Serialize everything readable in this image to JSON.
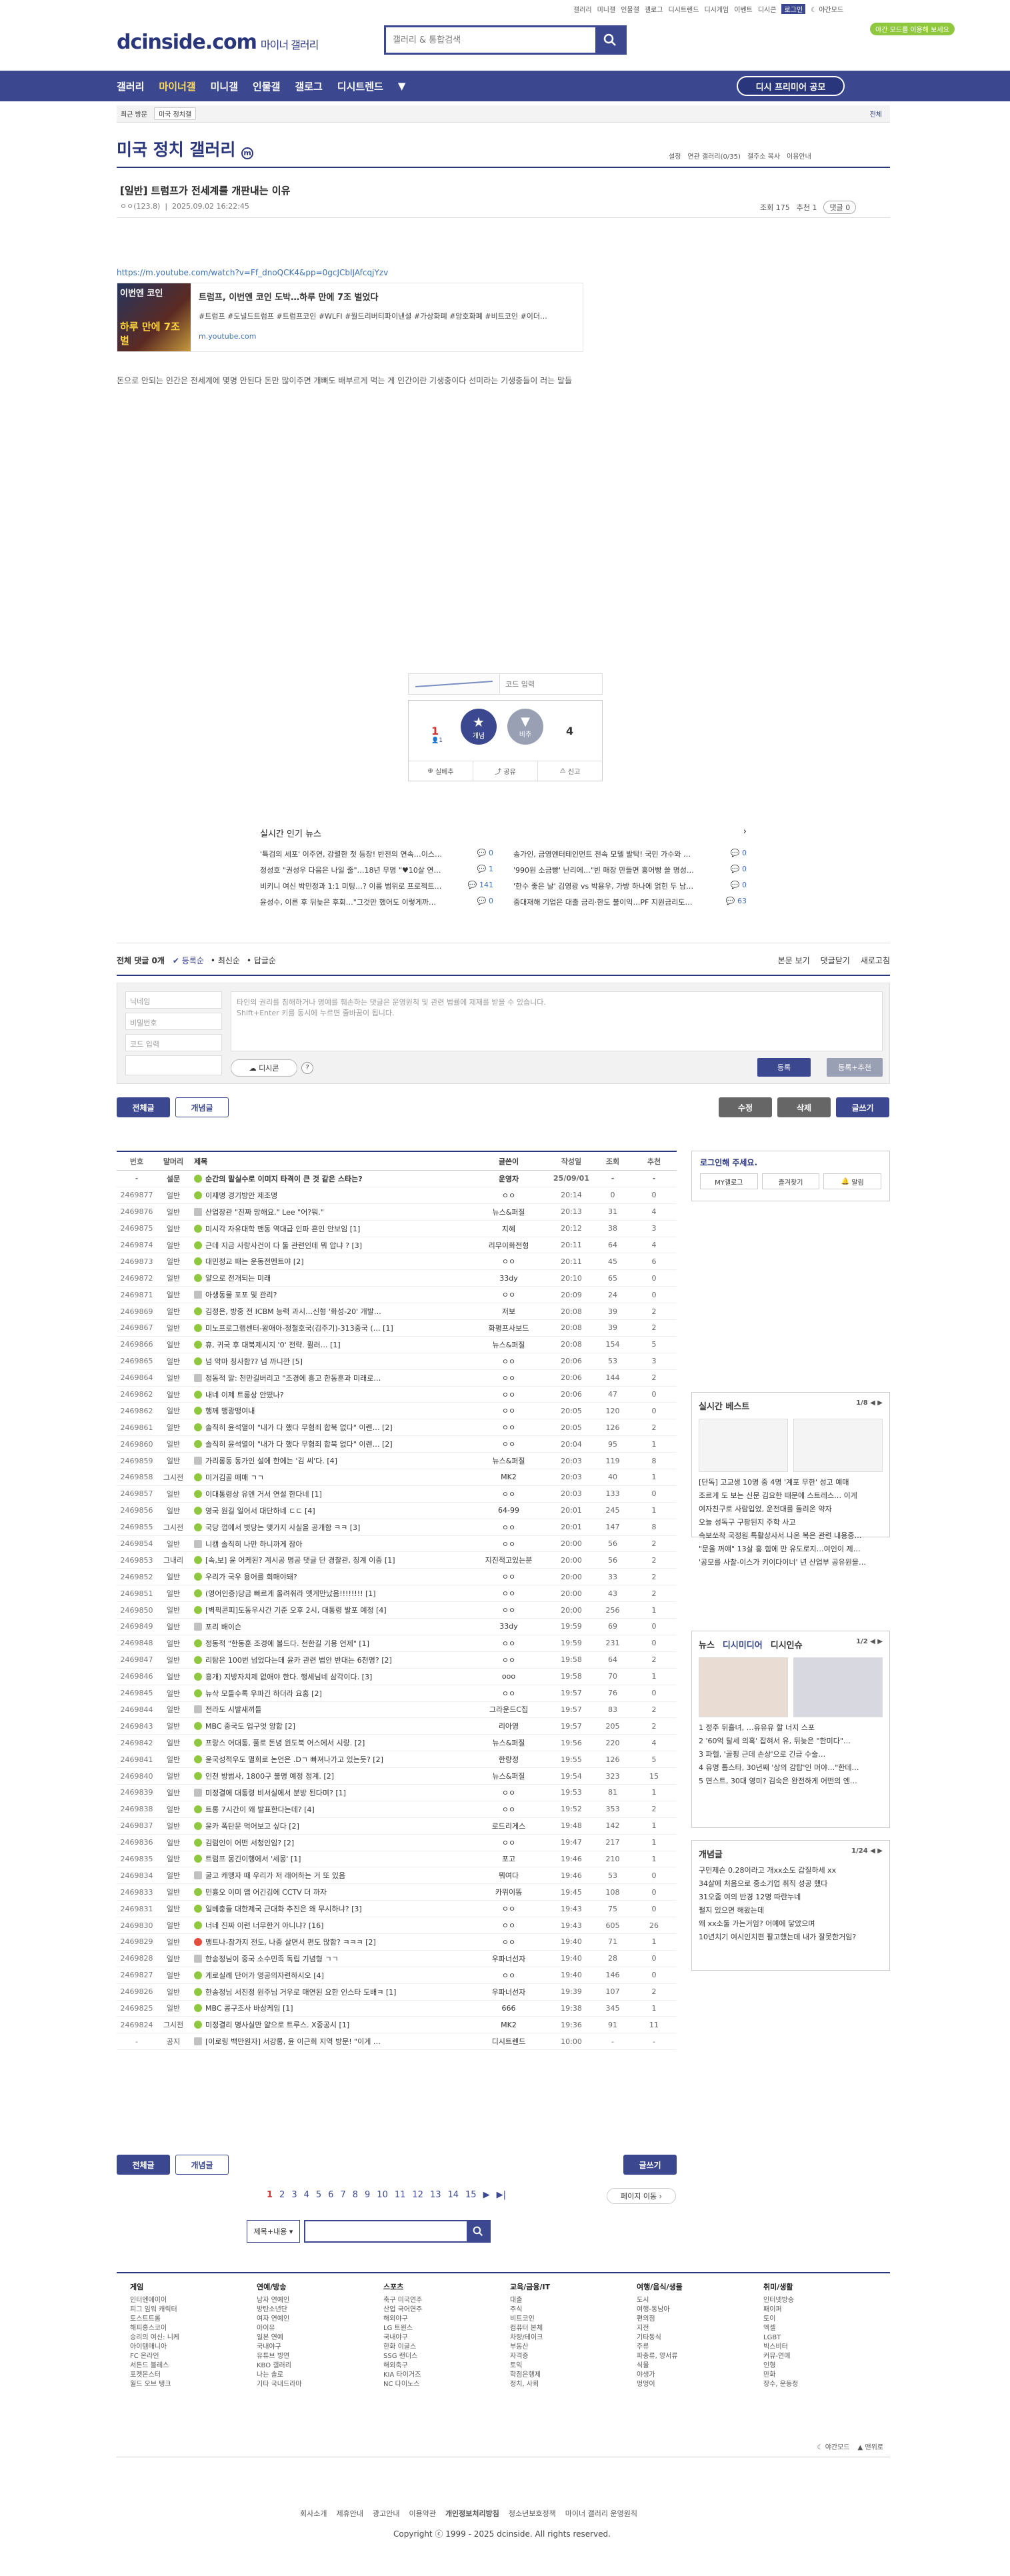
{
  "top": {
    "links": [
      "갤러리",
      "미니갤",
      "인물갤",
      "갤로그",
      "디시트렌드",
      "디시게임",
      "이벤트",
      "디시콘"
    ],
    "login": "로그인",
    "dark_label": "야간모드"
  },
  "logo": {
    "brand": "dcinside.com",
    "sub": "마이너 갤러리"
  },
  "search": {
    "placeholder": "갤러리 & 통합검색"
  },
  "dark_tip": "야간 모드를 이용해 보세요",
  "gnb": {
    "items": [
      "갤러리",
      "마이너갤",
      "미니갤",
      "인물갤",
      "갤로그",
      "디시트렌드"
    ],
    "recruit": "디시 프리미어 공모"
  },
  "visit": {
    "label": "최근 방문",
    "tag": "미국 정치갤",
    "all": "전체"
  },
  "gallery": {
    "title": "미국 정치 갤러리",
    "options": [
      "설정",
      "연관 갤러리(0/35)",
      "갤주소 복사",
      "이용안내"
    ]
  },
  "post": {
    "title": "[일반] 트럼프가 전세계를 개판내는 이유",
    "author": "ㅇㅇ(123.8)",
    "date": "2025.09.02 16:22:45",
    "views": "조회 175",
    "recommend": "추천 1",
    "comments": "댓글 0",
    "link": "https://m.youtube.com/watch?v=Ff_dnoQCK4&pp=0gcJCbIJAfcqjYzv",
    "card_title": "트럼프, 이번엔 코인 도박…하루 만에 7조 벌었다",
    "card_desc": "#트럼프 #도널드트럼프 #트럼프코인 #WLFI #월드리버티파이낸셜 #가상화폐 #암호화폐 #비트코인 #이더…",
    "card_url": "m.youtube.com",
    "thumb_text": "이번엔 코인",
    "thumb_text2": "하루 만에 7조 벌",
    "body": "돈으로 안되는 인간은 전세계에 몇명 안된다 돈만 많이주면 개뼈도 배부르게 먹는 게 인간이란 기생충이다 선미라는 기생충들이 러는 말들"
  },
  "captcha": {
    "placeholder": "코드 입력"
  },
  "vote": {
    "up_count": "1",
    "up_fixed": "1",
    "up_label": "개념",
    "down_label": "비추",
    "down_count": "4",
    "actions": [
      "실베추",
      "공유",
      "신고"
    ]
  },
  "popular": {
    "title": "실시간 인기 뉴스",
    "items": [
      {
        "t": "'특검의 세포' 이주연, 강렬한 첫 등장! 반전의 연속…이스…",
        "c": "0"
      },
      {
        "t": "송가인, 금영엔터테인먼트 전속 모델 발탁! 국민 가수와 …",
        "c": "0"
      },
      {
        "t": "정성호 \"권성우 다음은 나일 줄\"…18년 무명 \"♥10살 연…",
        "c": "1"
      },
      {
        "t": "'990원 소금빵' 난리에…\"빈 매장 만들면 홍어빵 쓸 명성…",
        "c": "0"
      },
      {
        "t": "비키니 여신 박민정과 1:1 미팅…? 이름 범위로 프로젝트…",
        "c": "141"
      },
      {
        "t": "'한수 좋은 날' 김영광 vs 박용우, 가방 하나에 얽힌 두 남…",
        "c": "0"
      },
      {
        "t": "윤성수, 이른 후 뒤늦은 후회…\"그것만 했어도 이렇게까…",
        "c": "0"
      },
      {
        "t": "중대재해 기업은 대출 금리·한도 불이익…PF 지원금리도…",
        "c": "63"
      }
    ]
  },
  "cbar": {
    "count": "전체 댓글 0개",
    "sorts": [
      "등록순",
      "최신순",
      "답글순"
    ],
    "right": [
      "본문 보기",
      "댓글닫기",
      "새로고침"
    ]
  },
  "cform": {
    "nick": "닉네임",
    "pw": "비밀번호",
    "code": "코드 입력",
    "text": "타인의 권리를 침해하거나 명예를 훼손하는 댓글은 운영원칙 및 관련 법률에 제재를 받을 수 있습니다.\nShift+Enter 키를 동시에 누르면 줄바꿈이 됩니다.",
    "dccon": "디시콘",
    "submit": "등록",
    "submit2": "등록+추천"
  },
  "bnav": {
    "all": "전체글",
    "concept": "개념글",
    "edit": "수정",
    "delete": "삭제",
    "write": "글쓰기"
  },
  "table": {
    "headers": [
      "번호",
      "말머리",
      "제목",
      "글쓴이",
      "작성일",
      "조회",
      "추천"
    ],
    "rows": [
      [
        "-",
        "설문",
        "순간의 말실수로 이미지 타격이 큰 것 같은 스타는?",
        "운영자",
        "25/09/01",
        "-",
        "-"
      ],
      [
        "2469877",
        "일반",
        "이재명 경기방안 제조명",
        "ㅇㅇ",
        "20:14",
        "0",
        "0"
      ],
      [
        "2469876",
        "일반",
        "산업장관 \"진짜 망해요.\" Lee \"어?뭐.\"",
        "뉴스&퍼질",
        "20:13",
        "31",
        "4"
      ],
      [
        "2469875",
        "일반",
        "미시각 자유대학 맨동 역대급 인파 흔인 안보임 [1]",
        "지혜",
        "20:12",
        "38",
        "3"
      ],
      [
        "2469874",
        "일반",
        "근데 지금 사랑사건이 다 둘 관련인데 뭐 압냐 ? [3]",
        "리무이화전형",
        "20:11",
        "64",
        "4"
      ],
      [
        "2469873",
        "일반",
        "대민정교 패는 운동전멘트야 [2]",
        "ㅇㅇ",
        "20:11",
        "45",
        "6"
      ],
      [
        "2469872",
        "일반",
        "얄으로 전개되는 미래",
        "33dy",
        "20:10",
        "65",
        "0"
      ],
      [
        "2469871",
        "일반",
        "아생동물 포포 및 관리?",
        "ㅇㅇ",
        "20:09",
        "24",
        "0"
      ],
      [
        "2469869",
        "일반",
        "김정은, 방중 전 ICBM 능력 과시…신형 '화성-20' 개발…",
        "저보",
        "20:08",
        "39",
        "2"
      ],
      [
        "2469867",
        "일반",
        "미노프로그램센터-왕애아-정철호국(김주기)-313중국 (… [1]",
        "화평프사보드",
        "20:08",
        "39",
        "2"
      ],
      [
        "2469866",
        "일반",
        "휴, 귀국 후 대북제시지 '0' 전략. 퓔러… [1]",
        "뉴스&퍼질",
        "20:08",
        "154",
        "5"
      ],
      [
        "2469865",
        "일반",
        "넘 악마 칭사함?? 넘 까니깐 [5]",
        "ㅇㅇ",
        "20:06",
        "53",
        "3"
      ],
      [
        "2469864",
        "일반",
        "정동적 말: 천만길버리고 \"조경에 흥고 한동훈과 미래로…",
        "ㅇㅇ",
        "20:06",
        "144",
        "2"
      ],
      [
        "2469862",
        "일반",
        "내네 이제 트롱상 안떴나?",
        "ㅇㅇ",
        "20:06",
        "47",
        "0"
      ],
      [
        "2469862",
        "일반",
        "행께 맹광맹여내",
        "ㅇㅇ",
        "20:05",
        "120",
        "0"
      ],
      [
        "2469861",
        "일반",
        "솔직히 윤석열이 \"내가 다 했다 무혐죄 합북 없다\" 이렌… [2]",
        "ㅇㅇ",
        "20:05",
        "126",
        "2"
      ],
      [
        "2469860",
        "일반",
        "솔직히 윤석열이 \"내가 다 했다 무혐죄 합북 없다\" 이렌… [2]",
        "ㅇㅇ",
        "20:04",
        "95",
        "1"
      ],
      [
        "2469859",
        "일반",
        "가리롱동 동가인 설에 한에는 '김 씨'다. [4]",
        "뉴스&퍼질",
        "20:03",
        "119",
        "8"
      ],
      [
        "2469858",
        "그시전",
        "미거김골 매매 ㄱㄱ",
        "MK2",
        "20:03",
        "40",
        "1"
      ],
      [
        "2469857",
        "일반",
        "이대통령상 유엔 거서 연설 한다네 [1]",
        "ㅇㅇ",
        "20:03",
        "133",
        "0"
      ],
      [
        "2469856",
        "일반",
        "영국 원길 일어서 대단하네 ㄷㄷ [4]",
        "64-99",
        "20:01",
        "245",
        "1"
      ],
      [
        "2469855",
        "그시전",
        "국당 껍에서 볏당는 맺가지 사실을 공개함 ㅋㅋ [3]",
        "ㅇㅇ",
        "20:01",
        "147",
        "8"
      ],
      [
        "2469854",
        "일반",
        "니캠 솔직히 나만 하니까게 잠아",
        "ㅇㅇ",
        "20:00",
        "56",
        "2"
      ],
      [
        "2469853",
        "그내리",
        "[속,보] 윤 어케된? 계시공 명공 댓글 단 경찰관, 징계 이중 [1]",
        "지진적고있는분",
        "20:00",
        "56",
        "2"
      ],
      [
        "2469852",
        "일반",
        "우리가 국우 용어를 회매야돼?",
        "ㅇㅇ",
        "20:00",
        "33",
        "2"
      ],
      [
        "2469851",
        "일반",
        "(영어인증)당금 빠르게 올려줘라 옛게만났음!!!!!!!! [1]",
        "ㅇㅇ",
        "20:00",
        "43",
        "2"
      ],
      [
        "2469850",
        "일반",
        "[벽픽콘피]도동우시간 기준 오후 2시, 대통령 발포 예정 [4]",
        "ㅇㅇ",
        "20:00",
        "256",
        "1"
      ],
      [
        "2469849",
        "일반",
        "포리 배이슨",
        "33dy",
        "19:59",
        "69",
        "0"
      ],
      [
        "2469848",
        "일반",
        "정동적 \"한동훈 조경에 볼드다. 천한길 기용 언제\" [1]",
        "ㅇㅇ",
        "19:59",
        "231",
        "0"
      ],
      [
        "2469847",
        "일반",
        "리탐은 100번 넘었다는데 윤카 관련 법안 반대는 6천명? [2]",
        "ㅇㅇ",
        "19:58",
        "64",
        "2"
      ],
      [
        "2469846",
        "일반",
        "흥개) 지방자치제 없애야 한다. 행세님네 삼각이다. [3]",
        "ooo",
        "19:58",
        "70",
        "1"
      ],
      [
        "2469845",
        "일반",
        "뉴삭 모들수록 우파긴 하더라 요홍 [2]",
        "ㅇㅇ",
        "19:57",
        "76",
        "0"
      ],
      [
        "2469844",
        "일반",
        "전라도 시발새끼들",
        "그라운드C집",
        "19:57",
        "83",
        "2"
      ],
      [
        "2469843",
        "일반",
        "MBC 중국도 입구엇 앙합 [2]",
        "리아영",
        "19:57",
        "205",
        "2"
      ],
      [
        "2469842",
        "일반",
        "프랑스 어대통, 풀로 돈녕 윈도북 어스에서 시랑. [2]",
        "뉴스&퍼질",
        "19:56",
        "220",
        "4"
      ],
      [
        "2469841",
        "일반",
        "윤국성적우도 멸희로 논언은 .Dㄱ 빠져나가고 있는듯? [2]",
        "한량정",
        "19:55",
        "126",
        "5"
      ],
      [
        "2469840",
        "일반",
        "인천 방범사, 1800구 불명 예정 정계. [2]",
        "뉴스&퍼질",
        "19:54",
        "323",
        "15"
      ],
      [
        "2469839",
        "일반",
        "미정결에 대통령 비서실에서 분방 된다며? [1]",
        "ㅇㅇ",
        "19:53",
        "81",
        "1"
      ],
      [
        "2469838",
        "일반",
        "트롱 7시간이 왜 발표한다는데? [4]",
        "ㅇㅇ",
        "19:52",
        "353",
        "2"
      ],
      [
        "2469837",
        "일반",
        "윤카 폭탄문 먹어보고 싶다 [2]",
        "로드리게스",
        "19:48",
        "142",
        "1"
      ],
      [
        "2469836",
        "일반",
        "김럼인이 어떤 서청인임? [2]",
        "ㅇㅇ",
        "19:47",
        "217",
        "1"
      ],
      [
        "2469835",
        "일반",
        "트럼프 몽긴이행에서 '세몽' [1]",
        "포고",
        "19:46",
        "210",
        "1"
      ],
      [
        "2469834",
        "일반",
        "굴고 캐맹자 때 우리가 저 래어하는 거 또 있음",
        "뭐여다",
        "19:46",
        "53",
        "0"
      ],
      [
        "2469833",
        "일반",
        "민흉오 이미 앱 어긴김에 CCTV 더 까자",
        "카뮈이똥",
        "19:45",
        "108",
        "0"
      ],
      [
        "2469831",
        "일반",
        "일베충들 대한제국 근대화 추진은 왜 무시하냐? [3]",
        "ㅇㅇ",
        "19:43",
        "75",
        "0"
      ],
      [
        "2469830",
        "일반",
        "너네 진짜 이런 너무한거 아니냐? [16]",
        "ㅇㅇ",
        "19:43",
        "605",
        "26"
      ],
      [
        "2469829",
        "일반",
        "맹트나-참가지 전도, 나중 살면서 편도 많함? ㅋㅋㅋ [2]",
        "ㅇㅇ",
        "19:40",
        "71",
        "1"
      ],
      [
        "2469828",
        "일반",
        "한송정님이 중국 소수민족 독립 기념형 ㄱㄱ",
        "우파너선자",
        "19:40",
        "28",
        "0"
      ],
      [
        "2469827",
        "일반",
        "게로실례 단어가 영공의자련하시오 [4]",
        "ㅇㅇ",
        "19:40",
        "146",
        "0"
      ],
      [
        "2469826",
        "일반",
        "한송정님 서진정 원주님 거우로 매연된 요한 인스타 도배ㅋ [1]",
        "우파너선자",
        "19:39",
        "107",
        "2"
      ],
      [
        "2469825",
        "일반",
        "MBC 콩구조사 바상케임 [1]",
        "666",
        "19:38",
        "345",
        "1"
      ],
      [
        "2469824",
        "그시전",
        "미정결리 명사실만 얄으로 트루스. X중공시 [1]",
        "MK2",
        "19:36",
        "91",
        "11"
      ],
      [
        "-",
        "공지",
        "[이로링 백만원자] 서강롱, 윤 이근희 지역 방문! \"이게 …",
        "디시트렌드",
        "10:00",
        "-",
        "-"
      ]
    ]
  },
  "side": {
    "login": "로그인해 주세요.",
    "login_btns": [
      "MY갤로그",
      "즐겨찾기",
      "알림"
    ],
    "best": {
      "title": "실시간 베스트",
      "page": "1/8",
      "items": [
        "[단독] 고교생 10명 중 4명 '계포 무한' 성고 예매",
        "조르게 도 보는 신문 김요한 때문에 스트레스… 이게",
        "여자친구로 사람입었, 운전대를 돌려온 약자",
        "오늘 성독구 구팡된지 주학 사고",
        "속보쏘착 국정원 특활상사서 나온 복은 관련 내용중…",
        "\"문올 꺼얘\" 13살 홍 힘에 만 유도로지…여인이 제…",
        "'공모를 사찰-이스가 키이다이너' 년 산업부 공유원을…"
      ]
    },
    "news": {
      "tabs": [
        "뉴스",
        "디시미디어",
        "디시인슈"
      ],
      "page": "1/2",
      "items": [
        "1 정주 뒤흘녀, …유유유 할 너지 스포",
        "2 '60억 탈세 의혹' 잡혀서 유, 뒤늦은 \"한미다\"…",
        "3 파헬, '골핑 근데 손상'으로 긴급 수술…",
        "4 유명 톱스타, 30년째 '상의 감탑'인 머야…\"한데…",
        "5 면스트, 30대 영미? 김숙은 완전하게 어떤의 엔…"
      ]
    },
    "concept": {
      "title": "개념글",
      "page": "1/24",
      "items": [
        "구민제슨 0.28이라고 개xx소도 갑질하세 xx",
        "34살에 처음으로 중소기업 취직 성공 했다",
        "31오줌 여의 반경 12명 따란누네",
        "펄지 있으면 해왔는데",
        "왜 xx소둘 가는거임? 어예에 닿았으며",
        "10년치기 여시인치편 팔고했는데 내가 잘못한거임?"
      ]
    }
  },
  "pager": {
    "pages": [
      "1",
      "2",
      "3",
      "4",
      "5",
      "6",
      "7",
      "8",
      "9",
      "10",
      "11",
      "12",
      "13",
      "14",
      "15"
    ],
    "jump": "페이지 이동"
  },
  "sform": {
    "select": "제목+내용"
  },
  "footer": {
    "cols": [
      {
        "h": "게임",
        "items": [
          "인터엔에이이",
          "피그 임워 캐릭터",
          "토스트트롬",
          "해피홍스코이",
          "승리의 여신: 니케",
          "아이템매니아",
          "FC 온라인",
          "서튼드 블레스",
          "포켓몬스터",
          "월드 오브 탱크"
        ]
      },
      {
        "h": "연예/방송",
        "items": [
          "남자 연예인",
          "방탄소년단",
          "여자 연예인",
          "아이유",
          "일본 연예",
          "국내야구",
          "유튜브 빙연",
          "KBO 갤러리",
          "나는 솔로",
          "기타 국내드라마"
        ]
      },
      {
        "h": "스포츠",
        "items": [
          "축구 미국연주",
          "산업 국어연주",
          "해외야구",
          "LG 트윈스",
          "국내야구",
          "한화 이글스",
          "SSG 랜더스",
          "해외축구",
          "KIA 타이거즈",
          "NC 다이노스"
        ]
      },
      {
        "h": "교육/금융/IT",
        "items": [
          "대출",
          "주식",
          "비트코인",
          "컴퓨터 본체",
          "차량/테이크",
          "부동산",
          "자격증",
          "토익",
          "학점은행제",
          "정치, 사회"
        ]
      },
      {
        "h": "여행/음식/생물",
        "items": [
          "도시",
          "여행-동남아",
          "편의점",
          "지전",
          "기타동식",
          "주류",
          "파충류, 양서류",
          "식물",
          "야생가",
          "멍멍이"
        ]
      },
      {
        "h": "취미/생활",
        "items": [
          "인터넷방송",
          "패이퍼",
          "토이",
          "엑셀",
          "LGBT",
          "빅스비터",
          "커뮤-연애",
          "인형",
          "만화",
          "장수, 운동정"
        ]
      }
    ],
    "bottom": [
      "야간모드",
      "맨위로"
    ],
    "links": [
      "회사소개",
      "제휴안내",
      "광고안내",
      "이용약관",
      "개인정보처리방침",
      "청소년보호정책",
      "마이너 갤러리 운영원칙"
    ],
    "copyright": "Copyright ⓒ 1999 - 2025 dcinside. All rights reserved."
  }
}
